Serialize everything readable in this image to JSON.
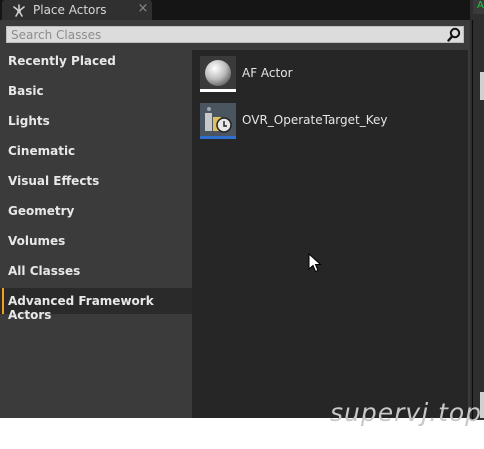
{
  "tab": {
    "title": "Place Actors",
    "icon": "place-actors-icon",
    "close_icon": "close-icon",
    "close_glyph": "×"
  },
  "right_edge": {
    "accent_text": "A"
  },
  "search": {
    "placeholder": "Search Classes",
    "value": "",
    "icon": "search-icon"
  },
  "categories": [
    {
      "label": "Recently Placed",
      "selected": false
    },
    {
      "label": "Basic",
      "selected": false
    },
    {
      "label": "Lights",
      "selected": false
    },
    {
      "label": "Cinematic",
      "selected": false
    },
    {
      "label": "Visual Effects",
      "selected": false
    },
    {
      "label": "Geometry",
      "selected": false
    },
    {
      "label": "Volumes",
      "selected": false
    },
    {
      "label": "All Classes",
      "selected": false
    },
    {
      "label": "Advanced Framework Actors",
      "selected": true
    }
  ],
  "items": [
    {
      "name": "AF Actor",
      "icon": "sphere-icon"
    },
    {
      "name": "OVR_OperateTarget_Key",
      "icon": "blueprint-key-icon"
    }
  ],
  "watermark": "supervj.top",
  "colors": {
    "accent": "#f0a01e",
    "panel": "#3b3b3b",
    "content": "#262626",
    "titlebar": "#151515"
  }
}
